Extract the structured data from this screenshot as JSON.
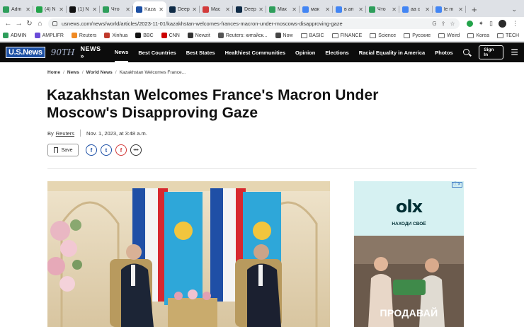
{
  "browser": {
    "tabs": [
      {
        "title": "Adm",
        "favicon_color": "#2e9e5b",
        "active": false
      },
      {
        "title": "(4) N",
        "favicon_color": "#22a34a",
        "active": false
      },
      {
        "title": "(1) N",
        "favicon_color": "#111111",
        "active": false
      },
      {
        "title": "Что",
        "favicon_color": "#2e9e5b",
        "active": false
      },
      {
        "title": "Kaza",
        "favicon_color": "#1c4fa3",
        "active": true
      },
      {
        "title": "Deep",
        "favicon_color": "#0f2b46",
        "active": false
      },
      {
        "title": "Mac",
        "favicon_color": "#d23b3b",
        "active": false
      },
      {
        "title": "Deep",
        "favicon_color": "#0f2b46",
        "active": false
      },
      {
        "title": "Мак",
        "favicon_color": "#2e9e5b",
        "active": false
      },
      {
        "title": "мак",
        "favicon_color": "#4285f4",
        "active": false
      },
      {
        "title": "в ап",
        "favicon_color": "#4285f4",
        "active": false
      },
      {
        "title": "Что",
        "favicon_color": "#2e9e5b",
        "active": false
      },
      {
        "title": "аа с",
        "favicon_color": "#4285f4",
        "active": false
      },
      {
        "title": "le m",
        "favicon_color": "#4285f4",
        "active": false
      }
    ],
    "url": "usnews.com/news/world/articles/2023-11-01/kazakhstan-welcomes-frances-macron-under-moscows-disapproving-gaze",
    "bookmarks": [
      {
        "label": "ADMIN",
        "kind": "site",
        "color": "#2e9e5b"
      },
      {
        "label": "AMPLIFR",
        "kind": "site",
        "color": "#6a4bd8"
      },
      {
        "label": "Reuters",
        "kind": "site",
        "color": "#f08a24"
      },
      {
        "label": "Xinhua",
        "kind": "site",
        "color": "#c0392b"
      },
      {
        "label": "BBC",
        "kind": "site",
        "color": "#111111"
      },
      {
        "label": "CNN",
        "kind": "site",
        "color": "#cc0000"
      },
      {
        "label": "Newzit",
        "kind": "site",
        "color": "#333333"
      },
      {
        "label": "Reuters: китайск...",
        "kind": "site",
        "color": "#555555"
      },
      {
        "label": "Now",
        "kind": "site",
        "color": "#444444"
      },
      {
        "label": "BASIC",
        "kind": "folder",
        "color": ""
      },
      {
        "label": "FINANCE",
        "kind": "folder",
        "color": ""
      },
      {
        "label": "Science",
        "kind": "folder",
        "color": ""
      },
      {
        "label": "Русские",
        "kind": "folder",
        "color": ""
      },
      {
        "label": "Weird",
        "kind": "folder",
        "color": ""
      },
      {
        "label": "Korea",
        "kind": "folder",
        "color": ""
      },
      {
        "label": "TECH",
        "kind": "folder",
        "color": ""
      }
    ]
  },
  "site": {
    "logo": "U.S.News",
    "anniversary": "90TH",
    "section": "NEWS »",
    "nav": [
      "News",
      "Best Countries",
      "Best States",
      "Healthiest Communities",
      "Opinion",
      "Elections",
      "Racial Equality in America",
      "Photos"
    ],
    "active_nav": "News",
    "signin": "Sign In"
  },
  "article": {
    "breadcrumb": [
      "Home",
      "News",
      "World News",
      "Kazakhstan Welcomes France..."
    ],
    "title": "Kazakhstan Welcomes France's Macron Under Moscow's Disapproving Gaze",
    "by": "By",
    "author": "Reuters",
    "date": "Nov. 1, 2023, at 3:48 a.m.",
    "save_label": "Save",
    "share": {
      "facebook": "f",
      "twitter": "t",
      "flipboard": "f",
      "more": "•••"
    }
  },
  "ad": {
    "brand": "olx",
    "tagline": "НАХОДИ СВОЁ",
    "cta": "ПРОДАВАЙ",
    "close": "ⓘ✕"
  },
  "colors": {
    "header_bg": "#0c0c0c",
    "brand_blue": "#1c4fa3",
    "ad_bg": "#d6f1f2"
  }
}
